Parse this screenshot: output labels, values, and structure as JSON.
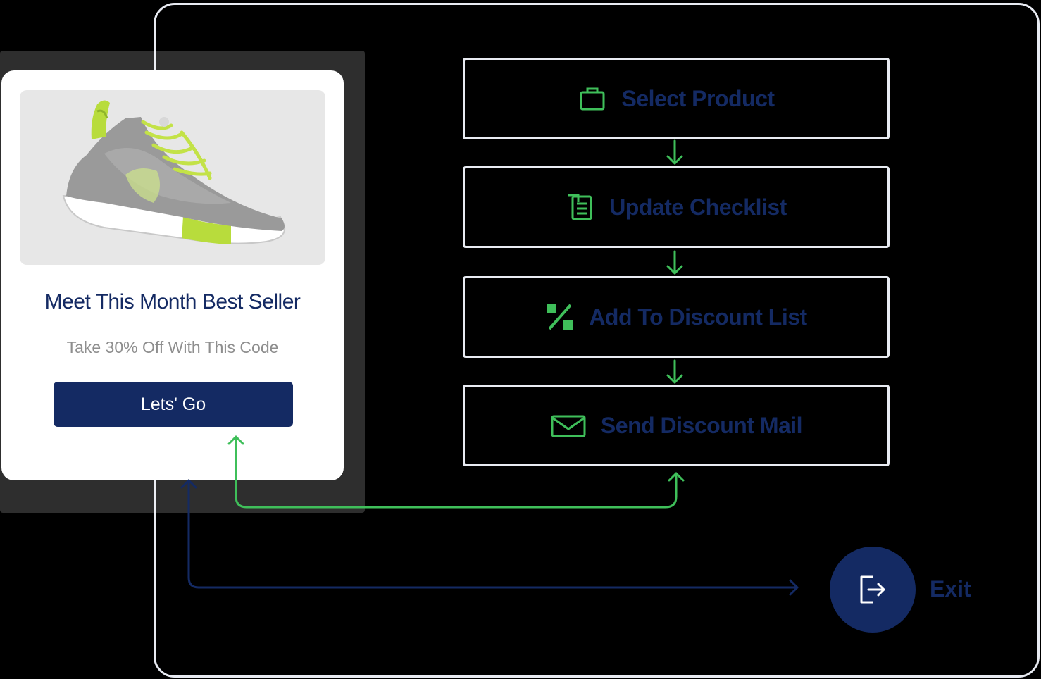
{
  "promo_card": {
    "title": "Meet This Month Best Seller",
    "subtitle": "Take 30% Off With This Code",
    "button_label": "Lets' Go",
    "image_icon": "sneaker-image"
  },
  "workflow": {
    "steps": [
      {
        "label": "Select Product",
        "icon": "bag-icon"
      },
      {
        "label": "Update Checklist",
        "icon": "checklist-icon"
      },
      {
        "label": "Add To Discount List",
        "icon": "percent-icon"
      },
      {
        "label": "Send Discount Mail",
        "icon": "mail-icon"
      }
    ]
  },
  "exit": {
    "label": "Exit",
    "icon": "logout-icon"
  },
  "colors": {
    "navy": "#142a63",
    "green": "#3fbf5a",
    "border": "#e8ebf2",
    "background": "#000000",
    "card": "#ffffff",
    "subtitle": "#8e8e8e"
  }
}
